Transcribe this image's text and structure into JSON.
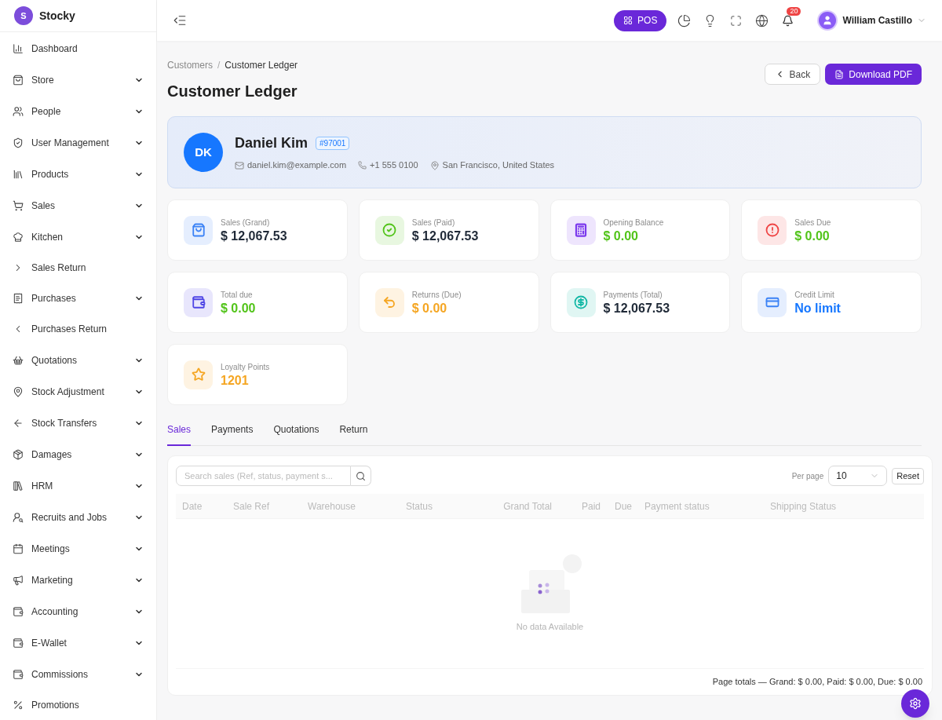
{
  "brand": {
    "logo_letter": "S",
    "name": "Stocky"
  },
  "sidebar": {
    "items": [
      {
        "label": "Dashboard",
        "expandable": false
      },
      {
        "label": "Store",
        "expandable": true
      },
      {
        "label": "People",
        "expandable": true
      },
      {
        "label": "User Management",
        "expandable": true
      },
      {
        "label": "Products",
        "expandable": true
      },
      {
        "label": "Sales",
        "expandable": true
      },
      {
        "label": "Kitchen",
        "expandable": true
      },
      {
        "label": "Sales Return",
        "expandable": false
      },
      {
        "label": "Purchases",
        "expandable": true
      },
      {
        "label": "Purchases Return",
        "expandable": false
      },
      {
        "label": "Quotations",
        "expandable": true
      },
      {
        "label": "Stock Adjustment",
        "expandable": true
      },
      {
        "label": "Stock Transfers",
        "expandable": true
      },
      {
        "label": "Damages",
        "expandable": true
      },
      {
        "label": "HRM",
        "expandable": true
      },
      {
        "label": "Recruits and Jobs",
        "expandable": true
      },
      {
        "label": "Meetings",
        "expandable": true
      },
      {
        "label": "Marketing",
        "expandable": true
      },
      {
        "label": "Accounting",
        "expandable": true
      },
      {
        "label": "E-Wallet",
        "expandable": true
      },
      {
        "label": "Commissions",
        "expandable": true
      },
      {
        "label": "Promotions",
        "expandable": false
      }
    ]
  },
  "header": {
    "pos_button": "POS",
    "notification_count": "20",
    "user_name": "William Castillo"
  },
  "breadcrumb": [
    "Customers",
    "/",
    "Customer Ledger"
  ],
  "page_title": "Customer Ledger",
  "actions": {
    "back": "Back",
    "download": "Download PDF"
  },
  "customer": {
    "initials": "DK",
    "name": "Daniel Kim",
    "code": "#97001",
    "email": "daniel.kim@example.com",
    "phone": "+1 555 0100",
    "location": "San Francisco, United States"
  },
  "stats": [
    {
      "label": "Sales (Grand)",
      "value": "$ 12,067.53",
      "color": "#3b82f6",
      "kind": "dark"
    },
    {
      "label": "Sales (Paid)",
      "value": "$ 12,067.53",
      "color": "#52c41a",
      "kind": "dark"
    },
    {
      "label": "Opening Balance",
      "value": "$ 0.00",
      "color": "#7c3aed",
      "kind": "green"
    },
    {
      "label": "Sales Due",
      "value": "$ 0.00",
      "color": "#ef4444",
      "kind": "green"
    },
    {
      "label": "Total due",
      "value": "$ 0.00",
      "color": "#4f46e5",
      "kind": "green"
    },
    {
      "label": "Returns (Due)",
      "value": "$ 0.00",
      "color": "#f5a623",
      "kind": "orange"
    },
    {
      "label": "Payments (Total)",
      "value": "$ 12,067.53",
      "color": "#14b8a6",
      "kind": "dark"
    },
    {
      "label": "Credit Limit",
      "value": "No limit",
      "color": "#3b82f6",
      "kind": "blue"
    },
    {
      "label": "Loyalty Points",
      "value": "1201",
      "color": "#f5a623",
      "kind": "orange"
    }
  ],
  "tabs": [
    {
      "label": "Sales",
      "selected": true
    },
    {
      "label": "Payments",
      "selected": false
    },
    {
      "label": "Quotations",
      "selected": false
    },
    {
      "label": "Return",
      "selected": false
    }
  ],
  "table": {
    "search": {
      "placeholder": "Search sales (Ref, status, payment s..."
    },
    "per_page_label": "Per page",
    "per_page": "10",
    "reset": "Reset",
    "columns": [
      "Date",
      "Sale Ref",
      "Warehouse",
      "Status",
      "Grand Total",
      "Paid",
      "Due",
      "Payment status",
      "Shipping Status"
    ],
    "empty": "No data Available",
    "totals": "Page totals — Grand: $ 0.00, Paid: $ 0.00, Due: $ 0.00"
  }
}
